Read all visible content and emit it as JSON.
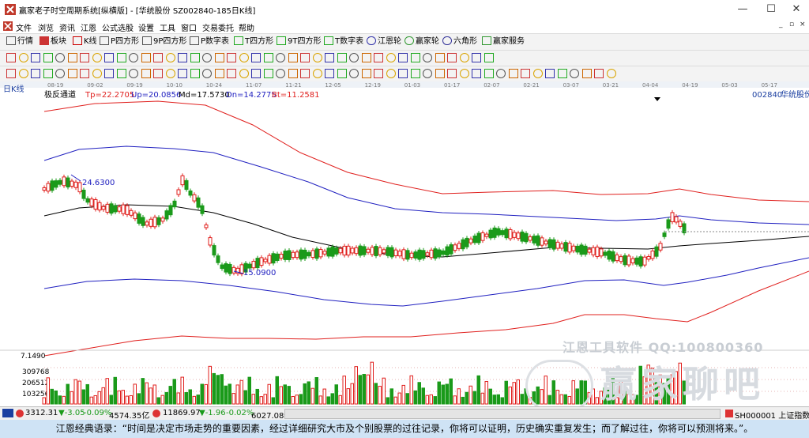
{
  "window": {
    "title": "赢家老子时空周期系统[纵横版] - [华统股份  SZ002840-185日K线]",
    "minimize_glyph": "—",
    "maximize_glyph": "☐",
    "close_glyph": "✕"
  },
  "menu": {
    "items": [
      "文件",
      "浏览",
      "资讯",
      "江恩",
      "公式选股",
      "设置",
      "工具",
      "窗口",
      "交易委托",
      "帮助"
    ],
    "mdi_controls": [
      "_",
      "▫",
      "×"
    ]
  },
  "toolbar": {
    "items": [
      "行情",
      "板块",
      "K线",
      "P四方形",
      "9P四方形",
      "P数字表",
      "T四方形",
      "9T四方形",
      "T数字表",
      "江恩轮",
      "赢家轮",
      "六角形",
      "赢家服务"
    ]
  },
  "chart": {
    "period_label": "日K线",
    "indicator_name": "极反通道",
    "params": [
      {
        "label": "Tp=22.2705",
        "color": "#e0201e"
      },
      {
        "label": "Up=20.0856",
        "color": "#2020c0"
      },
      {
        "label": "Md=17.5730",
        "color": "#000000"
      },
      {
        "label": "Dn=14.2775",
        "color": "#2020c0"
      },
      {
        "label": "Bt=11.2581",
        "color": "#e0201e"
      }
    ],
    "stock_code": "002840",
    "stock_name": "华统股份",
    "high_marker": "24.6300",
    "low_marker": "15.0900",
    "date_ticks": [
      "08-19",
      "09-02",
      "09-19",
      "10-10",
      "10-24",
      "11-07",
      "11-21",
      "12-05",
      "12-19",
      "01-03",
      "01-17",
      "02-07",
      "02-21",
      "03-07",
      "03-21",
      "04-04",
      "04-19",
      "05-03",
      "05-17"
    ],
    "vol_axis": [
      "7.1490",
      "309768",
      "206512",
      "103256"
    ],
    "colors": {
      "up": "#e0201e",
      "down": "#1a9a1a",
      "channel_outer": "#e0201e",
      "channel_inner": "#2020c0",
      "mid": "#000000"
    }
  },
  "chart_data": {
    "type": "candlestick",
    "title": "日K线",
    "series": [
      {
        "name": "Tp",
        "value": 22.2705
      },
      {
        "name": "Up",
        "value": 20.0856
      },
      {
        "name": "Md",
        "value": 17.573
      },
      {
        "name": "Dn",
        "value": 14.2775
      },
      {
        "name": "Bt",
        "value": 11.2581
      }
    ],
    "max_price_label": 24.63,
    "min_price_label": 15.09,
    "x_ticks": [
      "08-19",
      "09-02",
      "09-19",
      "10-10",
      "10-24",
      "11-07",
      "11-21",
      "12-05",
      "12-19",
      "01-03",
      "01-17",
      "02-07",
      "02-21",
      "03-07",
      "03-21",
      "04-04",
      "04-19",
      "05-03",
      "05-17"
    ],
    "volume_ticks": [
      309768,
      206512,
      103256
    ]
  },
  "status": {
    "index1": "3312.31",
    "index1_change": "▼-3.05",
    "index1_pct": "-0.09%",
    "index1_amount": "4574.35亿",
    "index2": "11869.97",
    "index2_change": "▼-1.96",
    "index2_pct": "-0.02%",
    "index2_amount": "6027.08亿",
    "right_label": "SH000001 上证指数"
  },
  "watermark": {
    "line1": "江恩工具软件  QQ:100800360",
    "line2": "赢家聊吧"
  },
  "quote": "江恩经典语录：“时间是决定市场走势的重要因素，经过详细研究大市及个别股票的过往记录，你将可以证明，历史确实重复发生；而了解过往，你将可以预测将来。”。"
}
